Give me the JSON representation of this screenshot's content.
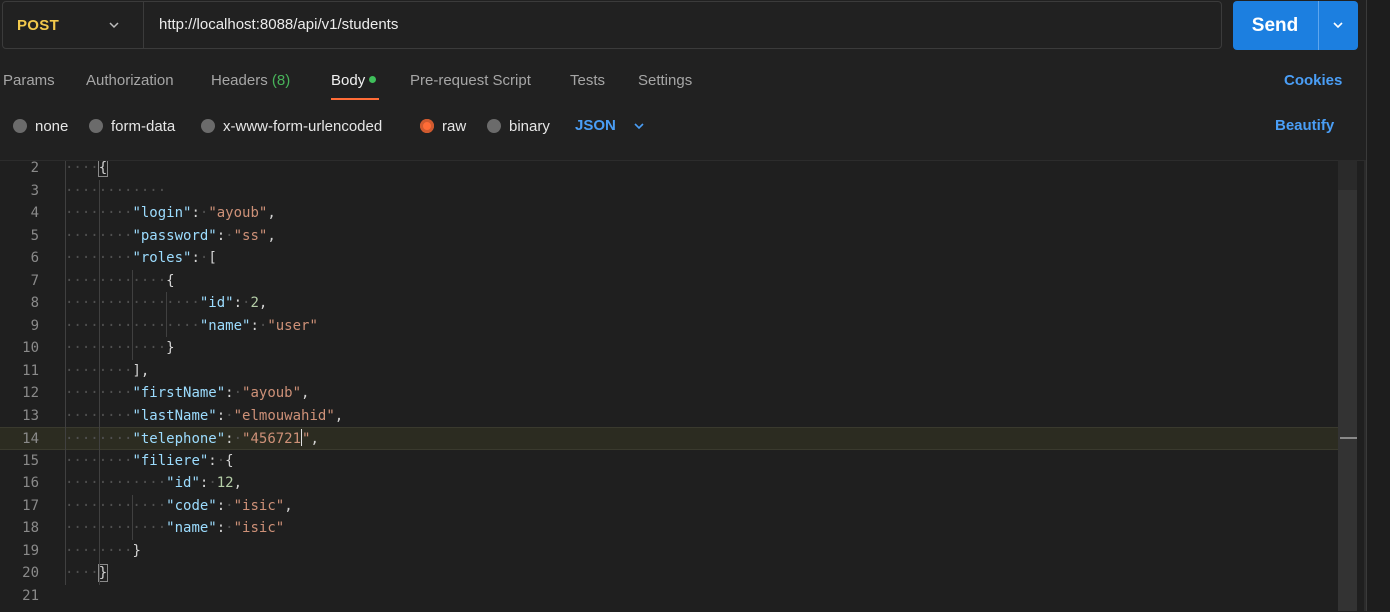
{
  "request": {
    "method": "POST",
    "url": "http://localhost:8088/api/v1/students",
    "send_label": "Send"
  },
  "tabs": [
    {
      "label": "Params"
    },
    {
      "label": "Authorization"
    },
    {
      "label": "Headers",
      "count": "(8)"
    },
    {
      "label": "Body"
    },
    {
      "label": "Pre-request Script"
    },
    {
      "label": "Tests"
    },
    {
      "label": "Settings"
    }
  ],
  "cookies_label": "Cookies",
  "body_types": [
    {
      "label": "none",
      "selected": false
    },
    {
      "label": "form-data",
      "selected": false
    },
    {
      "label": "x-www-form-urlencoded",
      "selected": false
    },
    {
      "label": "raw",
      "selected": true
    },
    {
      "label": "binary",
      "selected": false
    }
  ],
  "format_label": "JSON",
  "beautify_label": "Beautify",
  "colors": {
    "accent": "#ff6c37",
    "send_button": "#1c7fe0",
    "link_blue": "#4a9ef6",
    "method_yellow": "#f2c94c"
  },
  "editor": {
    "current_line": 14,
    "lines": [
      {
        "n": "2",
        "t": "{"
      },
      {
        "n": "3",
        "t": ""
      },
      {
        "n": "4",
        "key": "\"login\"",
        "val": "\"ayoub\"",
        "tail": ","
      },
      {
        "n": "5",
        "key": "\"password\"",
        "val": "\"ss\"",
        "tail": ","
      },
      {
        "n": "6",
        "key": "\"roles\"",
        "tail": "["
      },
      {
        "n": "7",
        "t": "{"
      },
      {
        "n": "8",
        "key": "\"id\"",
        "num": "2",
        "tail": ","
      },
      {
        "n": "9",
        "key": "\"name\"",
        "val": "\"user\"",
        "tail": ""
      },
      {
        "n": "10",
        "t": "}"
      },
      {
        "n": "11",
        "t": "],"
      },
      {
        "n": "12",
        "key": "\"firstName\"",
        "val": "\"ayoub\"",
        "tail": ","
      },
      {
        "n": "13",
        "key": "\"lastName\"",
        "val": "\"elmouwahid\"",
        "tail": ","
      },
      {
        "n": "14",
        "key": "\"telephone\"",
        "val": "\"456721\"",
        "tail": ","
      },
      {
        "n": "15",
        "key": "\"filiere\"",
        "tail": "{"
      },
      {
        "n": "16",
        "key": "\"id\"",
        "num": "12",
        "tail": ","
      },
      {
        "n": "17",
        "key": "\"code\"",
        "val": "\"isic\"",
        "tail": ","
      },
      {
        "n": "18",
        "key": "\"name\"",
        "val": "\"isic\"",
        "tail": ""
      },
      {
        "n": "19",
        "t": "}"
      },
      {
        "n": "20",
        "t": "}"
      },
      {
        "n": "21",
        "t": ""
      }
    ]
  }
}
